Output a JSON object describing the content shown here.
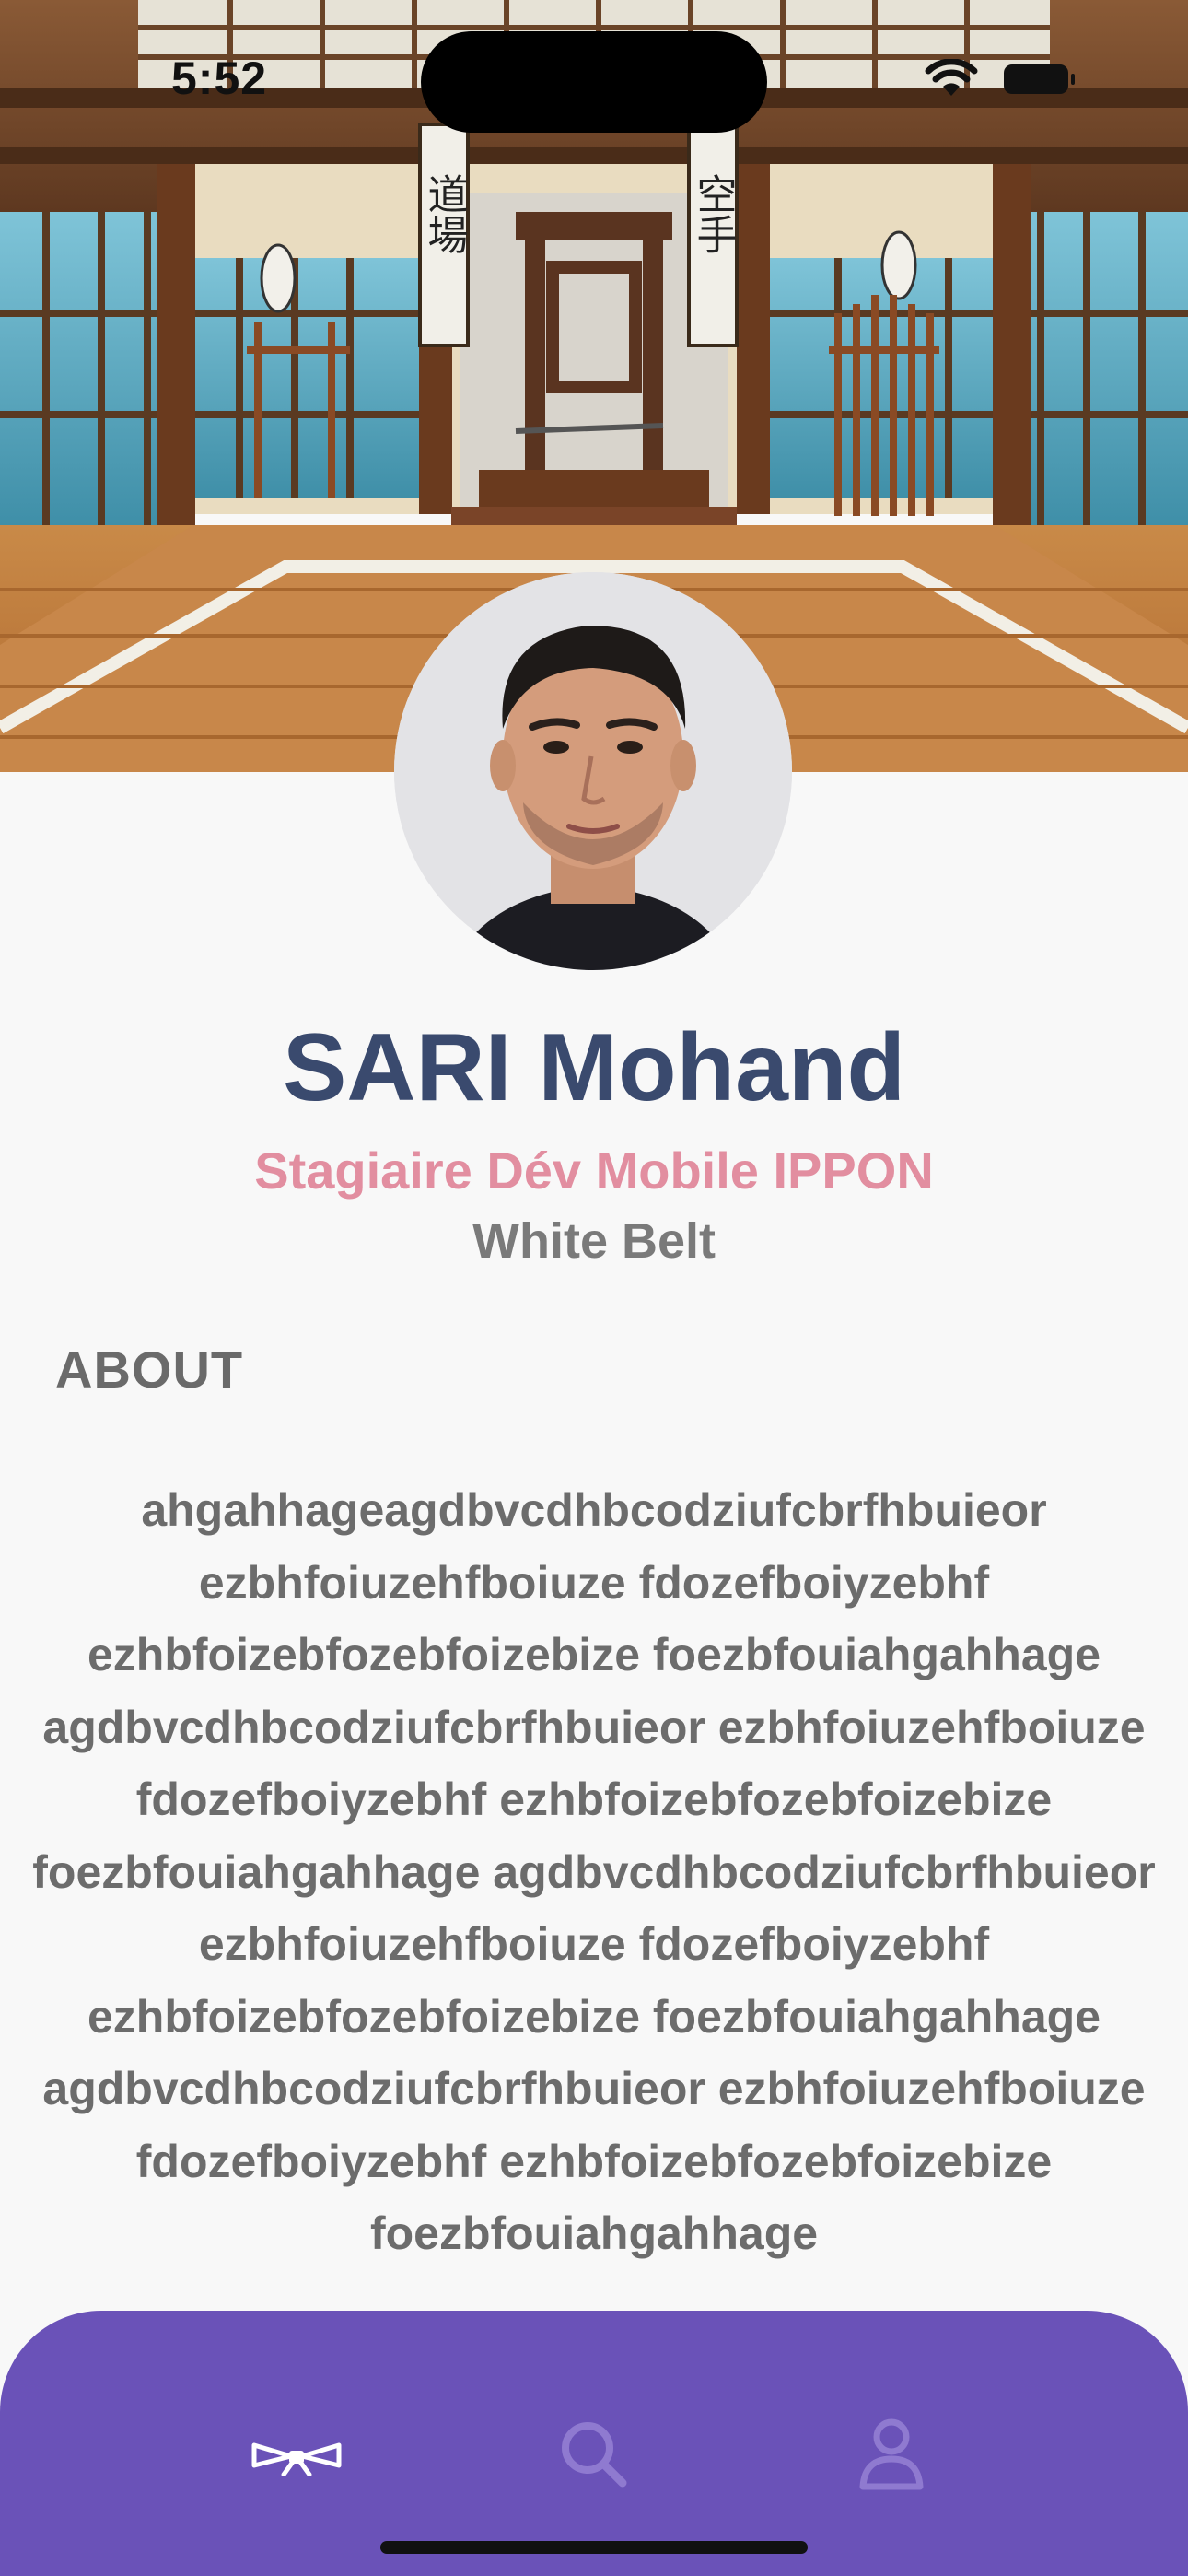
{
  "status_bar": {
    "time": "5:52"
  },
  "banner": {
    "left_sign": "道場",
    "right_sign": "空手"
  },
  "profile": {
    "name": "SARI Mohand",
    "role": "Stagiaire Dév Mobile IPPON",
    "belt": "White Belt"
  },
  "about": {
    "title": "ABOUT",
    "text": "ahgahhageagdbvcdhbcodziufcbrfhbuieor ezbhfoiuzehfboiuze fdozefboiyzebhf ezhbfoizebfozebfoizebize foezbfouiahgahhage agdbvcdhbcodziufcbrfhbuieor ezbhfoiuzehfboiuze fdozefboiyzebhf ezhbfoizebfozebfoizebize foezbfouiahgahhage agdbvcdhbcodziufcbrfhbuieor ezbhfoiuzehfboiuze fdozefboiyzebhf ezhbfoizebfozebfoizebize foezbfouiahgahhage agdbvcdhbcodziufcbrfhbuieor ezbhfoiuzehfboiuze fdozefboiyzebhf ezhbfoizebfozebfoizebize foezbfouiahgahhage"
  },
  "tab_bar": {
    "background": "#6a52b8",
    "tabs": [
      {
        "icon": "belt-icon",
        "active": true
      },
      {
        "icon": "search-icon",
        "active": false
      },
      {
        "icon": "person-icon",
        "active": false
      }
    ]
  },
  "colors": {
    "name": "#3a4a6e",
    "role": "#e28ea0",
    "belt": "#7a7a7a",
    "about_text": "#6c6c6c",
    "tab_inactive_icon": "#8f7ad0"
  }
}
